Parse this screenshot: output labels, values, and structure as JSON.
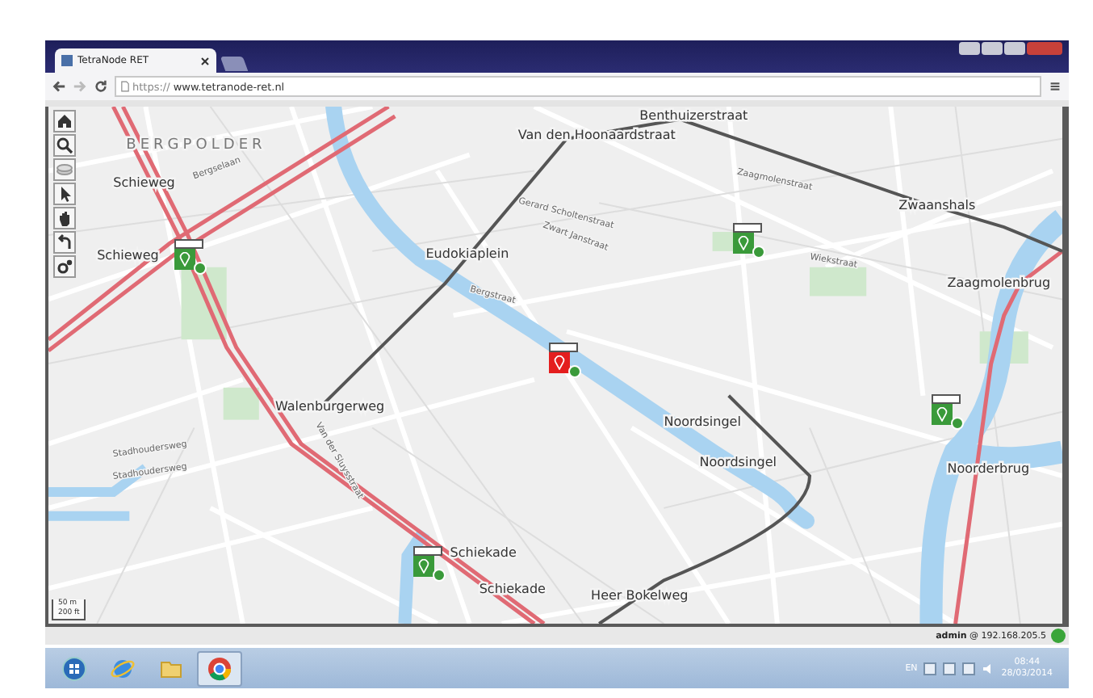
{
  "browser": {
    "tab_title": "TetraNode RET",
    "url_scheme": "https://",
    "url_host": "www.tetranode-ret.nl"
  },
  "map": {
    "district": "BERGPOLDER",
    "labels": [
      {
        "text": "Schieweg",
        "kind": "stop"
      },
      {
        "text": "Schieweg",
        "kind": "stop"
      },
      {
        "text": "Van den Hoonaardstraat",
        "kind": "stop"
      },
      {
        "text": "Benthuizerstraat",
        "kind": "stop"
      },
      {
        "text": "Eudokiaplein",
        "kind": "stop"
      },
      {
        "text": "Zwaanshals",
        "kind": "stop"
      },
      {
        "text": "Zaagmolenbrug",
        "kind": "stop"
      },
      {
        "text": "Walenburgerweg",
        "kind": "stop"
      },
      {
        "text": "Noordsingel",
        "kind": "stop"
      },
      {
        "text": "Noordsingel",
        "kind": "stop"
      },
      {
        "text": "Noorderbrug",
        "kind": "stop"
      },
      {
        "text": "Schiekade",
        "kind": "stop"
      },
      {
        "text": "Schiekade",
        "kind": "stop"
      },
      {
        "text": "Heer Bokelweg",
        "kind": "stop"
      },
      {
        "text": "Bergselaan",
        "kind": "street"
      },
      {
        "text": "Gerard Scholtenstraat",
        "kind": "street"
      },
      {
        "text": "Zwart Janstraat",
        "kind": "street"
      },
      {
        "text": "Stadhoudersweg",
        "kind": "street"
      },
      {
        "text": "Stadhoudersweg",
        "kind": "street"
      },
      {
        "text": "Zaagmolenstraat",
        "kind": "street"
      },
      {
        "text": "Wiekstraat",
        "kind": "street"
      },
      {
        "text": "Van der Sluysstraat",
        "kind": "street"
      },
      {
        "text": "Bergstraat",
        "kind": "street"
      }
    ],
    "markers": [
      {
        "color": "#3a9a3a"
      },
      {
        "color": "#3a9a3a"
      },
      {
        "color": "#e41e1e"
      },
      {
        "color": "#3a9a3a"
      },
      {
        "color": "#3a9a3a"
      }
    ],
    "scale": [
      "50 m",
      "200 ft"
    ]
  },
  "status_bar": {
    "user": "**admin** @ 192.168.205.5"
  },
  "taskbar": {
    "apps": [
      {
        "kind": "start",
        "selected": false
      },
      {
        "kind": "ie",
        "selected": false
      },
      {
        "kind": "folder",
        "selected": false
      },
      {
        "kind": "chrome",
        "selected": true
      }
    ],
    "language": "EN",
    "time": "08:44",
    "date": "28/03/2014"
  }
}
